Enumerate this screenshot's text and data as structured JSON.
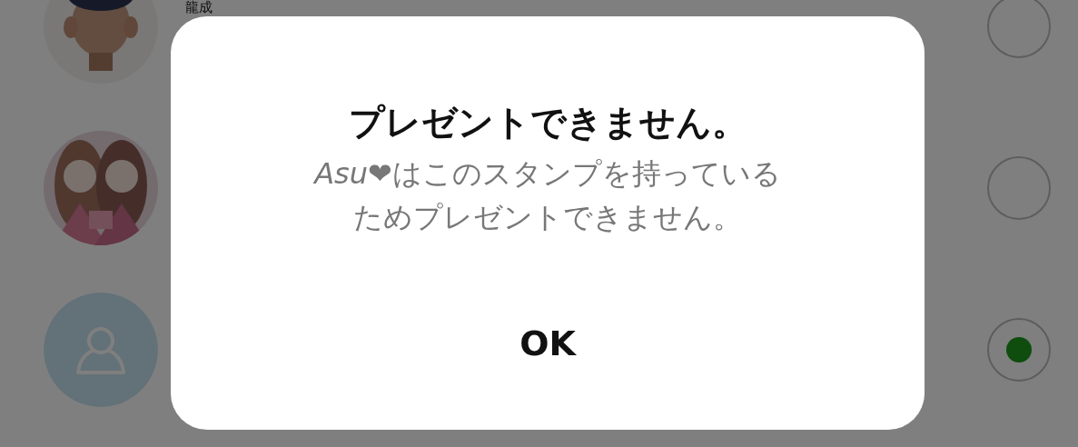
{
  "friends": [
    {
      "name": "龍成",
      "kind": "picture",
      "selected": false
    },
    {
      "kind": "picture",
      "selected": false
    },
    {
      "kind": "default",
      "selected": true
    }
  ],
  "dialog": {
    "title": "プレゼントできません。",
    "message_lines": [
      "*Asu*❤はこのスタンプを持っている",
      "ためプレゼントできません。"
    ],
    "button": "OK"
  }
}
